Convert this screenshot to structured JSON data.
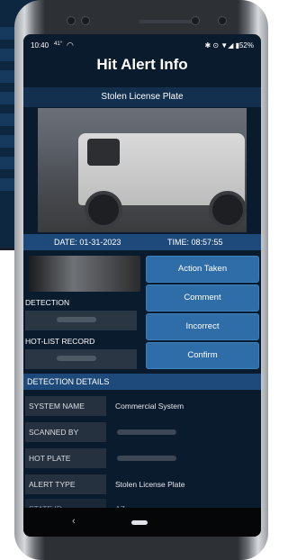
{
  "status_bar": {
    "time": "10:40",
    "temp": "41°",
    "right_icons": "✱ ⊙ ▼◢ ▮52%"
  },
  "page": {
    "title": "Hit Alert Info"
  },
  "alert": {
    "type_header": "Stolen License Plate",
    "date": "DATE: 01-31-2023",
    "time": "TIME: 08:57:55"
  },
  "labels": {
    "detection": "DETECTION",
    "hotlist_record": "HOT-LIST RECORD",
    "detection_details": "DETECTION DETAILS"
  },
  "actions": {
    "action_taken": "Action Taken",
    "comment": "Comment",
    "incorrect": "Incorrect",
    "confirm": "Confirm"
  },
  "details": [
    {
      "key": "SYSTEM NAME",
      "value": "Commercial System"
    },
    {
      "key": "SCANNED BY",
      "value": ""
    },
    {
      "key": "HOT PLATE",
      "value": ""
    },
    {
      "key": "ALERT TYPE",
      "value": "Stolen License Plate"
    },
    {
      "key": "STATE ID",
      "value": "AZ"
    }
  ],
  "nav": {
    "back": "‹"
  }
}
